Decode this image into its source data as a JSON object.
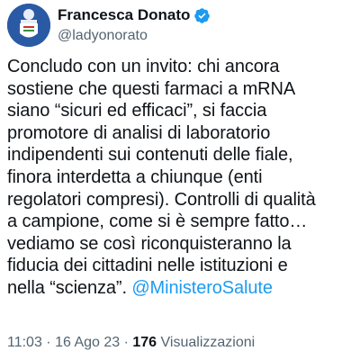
{
  "author": {
    "display_name": "Francesca Donato",
    "handle": "@ladyonorato",
    "verified_icon": "verified-badge-icon",
    "avatar": "profile-avatar",
    "accent_color": "#1d9bf0"
  },
  "tweet": {
    "lines": [
      "Concludo con un invito: chi ancora",
      "sostiene che questi farmaci a mRNA",
      "siano “sicuri ed efficaci”, si faccia",
      "promotore di analisi di laboratorio",
      "indipendenti sui contenuti delle fiale,",
      "finora interdetta a chiunque (enti",
      "regolatori compresi). Controlli di qualità",
      "a campione, come si è sempre fatto…",
      "vediamo se così riconquisteranno la",
      "fiducia dei cittadini nelle istituzioni e"
    ],
    "last_line_text": "nella “scienza”. ",
    "mention": "@MinisteroSalute"
  },
  "meta": {
    "time": "11:03",
    "separator": " · ",
    "date": "16 Ago 23",
    "views_count": "176",
    "views_label": " Visualizzazioni"
  }
}
